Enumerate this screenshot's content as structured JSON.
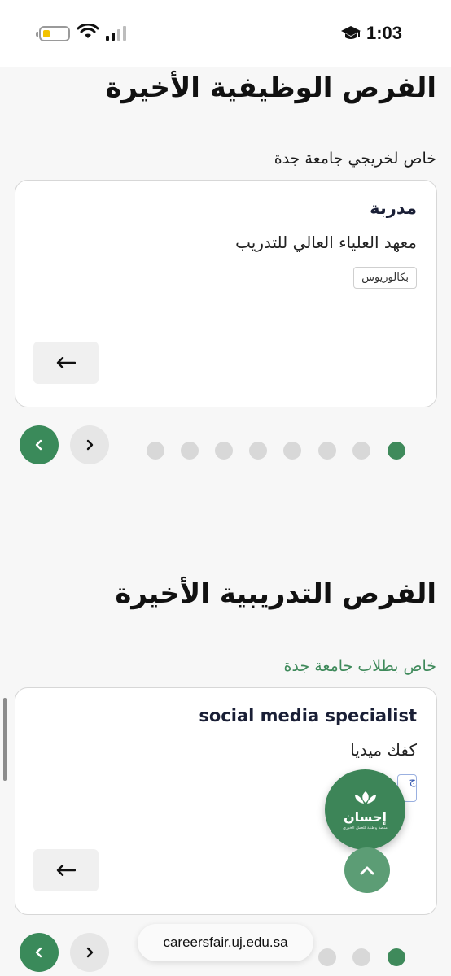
{
  "status_bar": {
    "time": "1:03",
    "battery_level": 0.2,
    "battery_color": "#f2c200"
  },
  "jobs_section": {
    "title": "الفرص الوظيفية الأخيرة",
    "subtitle": "خاص لخريجي جامعة جدة",
    "card": {
      "title": "مدربة",
      "organization": "معهد العلياء العالي للتدريب",
      "tag": "بكالوريوس",
      "arrow": "←"
    },
    "pagination": {
      "total": 8,
      "active_index": 0
    }
  },
  "training_section": {
    "title": "الفرص التدريبية الأخيرة",
    "subtitle": "خاص بطلاب جامعة جدة",
    "card": {
      "title": "social media specialist",
      "organization": "كفك ميديا",
      "tag": "ج",
      "arrow": "←"
    },
    "pagination": {
      "total": 8,
      "active_index": 0
    }
  },
  "floating": {
    "badge_name": "إحسان",
    "badge_subtitle": "منصة وطنية للعمل الخيري"
  },
  "browser": {
    "url": "careersfair.uj.edu.sa"
  },
  "colors": {
    "accent": "#3a8a5a",
    "accent_light": "#5c9d75",
    "background": "#f7f7f7",
    "training_subtitle": "#3f8a5b"
  }
}
